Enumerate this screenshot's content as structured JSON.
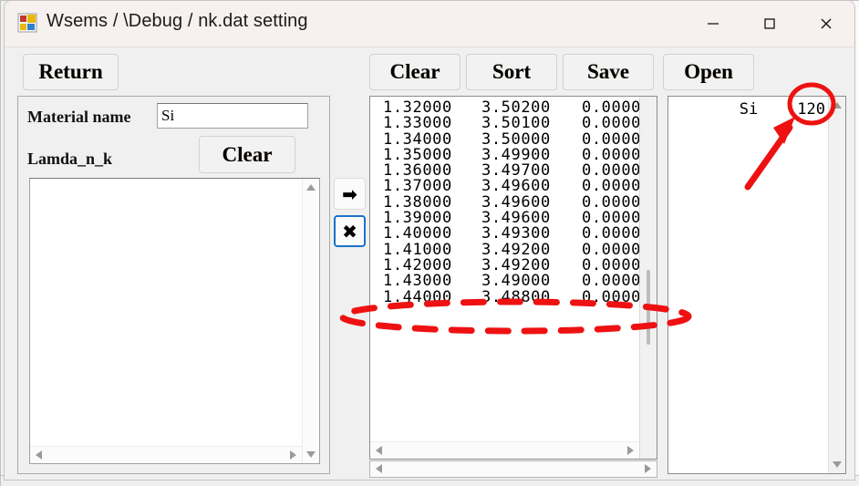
{
  "window": {
    "title": "Wsems / \\Debug / nk.dat setting",
    "icon": "app-window-icon",
    "controls": {
      "minimize": "minimize-icon",
      "maximize": "maximize-icon",
      "close": "close-icon"
    }
  },
  "toolbar": {
    "return_label": "Return",
    "clear_label": "Clear",
    "sort_label": "Sort",
    "save_label": "Save",
    "open_label": "Open"
  },
  "left_panel": {
    "material_name_label": "Material name",
    "material_name_value": "Si",
    "lamda_label": "Lamda_n_k",
    "clear_label": "Clear",
    "list_items": []
  },
  "transfer": {
    "move_right_icon": "arrow-right-icon",
    "delete_icon": "cross-x-icon"
  },
  "data_list": {
    "rows": [
      {
        "lamda": "1.32000",
        "n": "3.50200",
        "k": "0.00000"
      },
      {
        "lamda": "1.33000",
        "n": "3.50100",
        "k": "0.00000"
      },
      {
        "lamda": "1.34000",
        "n": "3.50000",
        "k": "0.00000"
      },
      {
        "lamda": "1.35000",
        "n": "3.49900",
        "k": "0.00000"
      },
      {
        "lamda": "1.36000",
        "n": "3.49700",
        "k": "0.00000"
      },
      {
        "lamda": "1.37000",
        "n": "3.49600",
        "k": "0.00000"
      },
      {
        "lamda": "1.38000",
        "n": "3.49600",
        "k": "0.00000"
      },
      {
        "lamda": "1.39000",
        "n": "3.49600",
        "k": "0.00000"
      },
      {
        "lamda": "1.40000",
        "n": "3.49300",
        "k": "0.00000"
      },
      {
        "lamda": "1.41000",
        "n": "3.49200",
        "k": "0.00000"
      },
      {
        "lamda": "1.42000",
        "n": "3.49200",
        "k": "0.00000"
      },
      {
        "lamda": "1.43000",
        "n": "3.49000",
        "k": "0.00000"
      },
      {
        "lamda": "1.44000",
        "n": "3.48800",
        "k": "0.00000"
      }
    ]
  },
  "material_list": {
    "name": "Si",
    "count": "120"
  },
  "annotations": {
    "highlight_color": "#ee1111",
    "circle_target": "120",
    "ellipse_target": "last-data-row"
  }
}
